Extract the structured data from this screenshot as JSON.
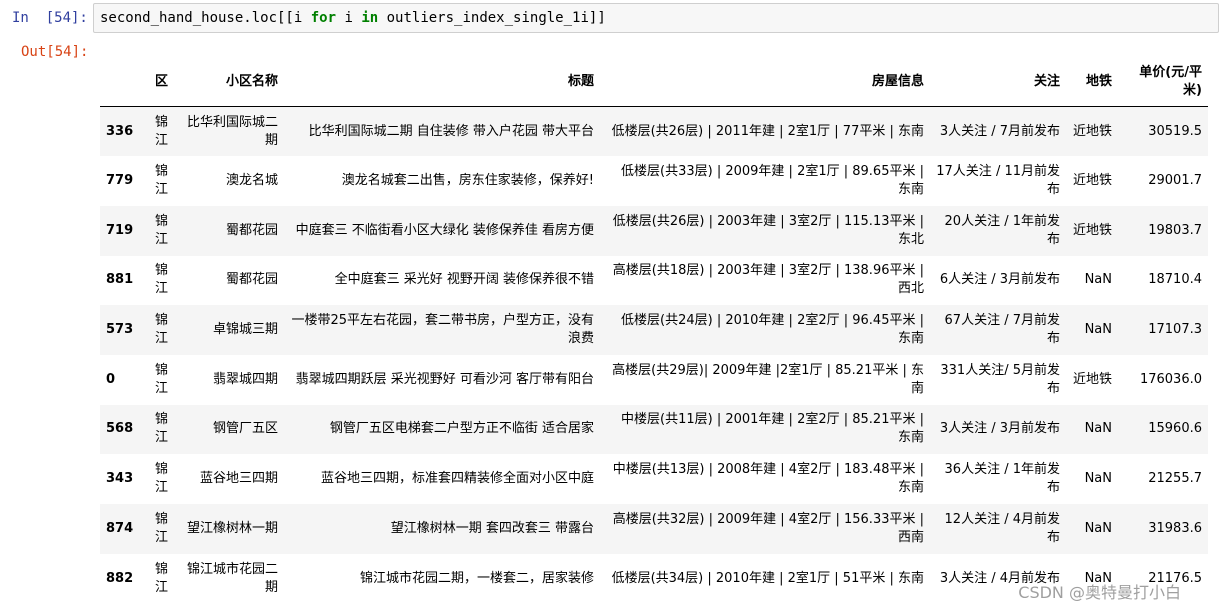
{
  "input_prompt": "In  [54]:",
  "output_prompt": "Out[54]:",
  "code": {
    "part1": "second_hand_house.loc[[i ",
    "kw1": "for",
    "part2": " i ",
    "kw2": "in",
    "part3": " outliers_index_single_1i]]"
  },
  "table": {
    "columns": [
      "",
      "区",
      "小区名称",
      "标题",
      "房屋信息",
      "关注",
      "地铁",
      "单价(元/平米)"
    ],
    "rows": [
      {
        "index": "336",
        "cells": [
          "锦江",
          "比华利国际城二期",
          "比华利国际城二期 自住装修 带入户花园 带大平台",
          "低楼层(共26层) | 2011年建 | 2室1厅 | 77平米 | 东南",
          "3人关注 / 7月前发布",
          "近地铁",
          "30519.5"
        ]
      },
      {
        "index": "779",
        "cells": [
          "锦江",
          "澳龙名城",
          "澳龙名城套二出售，房东住家装修，保养好!",
          "低楼层(共33层) | 2009年建 | 2室1厅 | 89.65平米 | 东南",
          "17人关注 / 11月前发布",
          "近地铁",
          "29001.7"
        ]
      },
      {
        "index": "719",
        "cells": [
          "锦江",
          "蜀都花园",
          "中庭套三 不临街看小区大绿化 装修保养佳 看房方便",
          "低楼层(共26层) | 2003年建 | 3室2厅 | 115.13平米 | 东北",
          "20人关注 / 1年前发布",
          "近地铁",
          "19803.7"
        ]
      },
      {
        "index": "881",
        "cells": [
          "锦江",
          "蜀都花园",
          "全中庭套三 采光好 视野开阔 装修保养很不错",
          "高楼层(共18层) | 2003年建 | 3室2厅 | 138.96平米 | 西北",
          "6人关注 / 3月前发布",
          "NaN",
          "18710.4"
        ]
      },
      {
        "index": "573",
        "cells": [
          "锦江",
          "卓锦城三期",
          "一楼带25平左右花园，套二带书房，户型方正，没有浪费",
          "低楼层(共24层) | 2010年建 | 2室2厅 | 96.45平米 | 东南",
          "67人关注 / 7月前发布",
          "NaN",
          "17107.3"
        ]
      },
      {
        "index": "0",
        "cells": [
          "锦江",
          "翡翠城四期",
          "翡翠城四期跃层 采光视野好 可看沙河 客厅带有阳台",
          "高楼层(共29层)| 2009年建 |2室1厅 | 85.21平米 | 东南",
          "331人关注/ 5月前发布",
          "近地铁",
          "176036.0"
        ]
      },
      {
        "index": "568",
        "cells": [
          "锦江",
          "钢管厂五区",
          "钢管厂五区电梯套二户型方正不临街 适合居家",
          "中楼层(共11层) | 2001年建 | 2室2厅 | 85.21平米 | 东南",
          "3人关注 / 3月前发布",
          "NaN",
          "15960.6"
        ]
      },
      {
        "index": "343",
        "cells": [
          "锦江",
          "蓝谷地三四期",
          "蓝谷地三四期，标准套四精装修全面对小区中庭",
          "中楼层(共13层) | 2008年建 | 4室2厅 | 183.48平米 | 东南",
          "36人关注 / 1年前发布",
          "NaN",
          "21255.7"
        ]
      },
      {
        "index": "874",
        "cells": [
          "锦江",
          "望江橡树林一期",
          "望江橡树林一期 套四改套三 带露台",
          "高楼层(共32层) | 2009年建 | 4室2厅 | 156.33平米 | 西南",
          "12人关注 / 4月前发布",
          "NaN",
          "31983.6"
        ]
      },
      {
        "index": "882",
        "cells": [
          "锦江",
          "锦江城市花园二期",
          "锦江城市花园二期，一楼套二，居家装修",
          "低楼层(共34层) | 2010年建 | 2室1厅 | 51平米 | 东南",
          "3人关注 / 4月前发布",
          "NaN",
          "21176.5"
        ]
      }
    ]
  },
  "watermark": "CSDN @奥特曼打小白"
}
